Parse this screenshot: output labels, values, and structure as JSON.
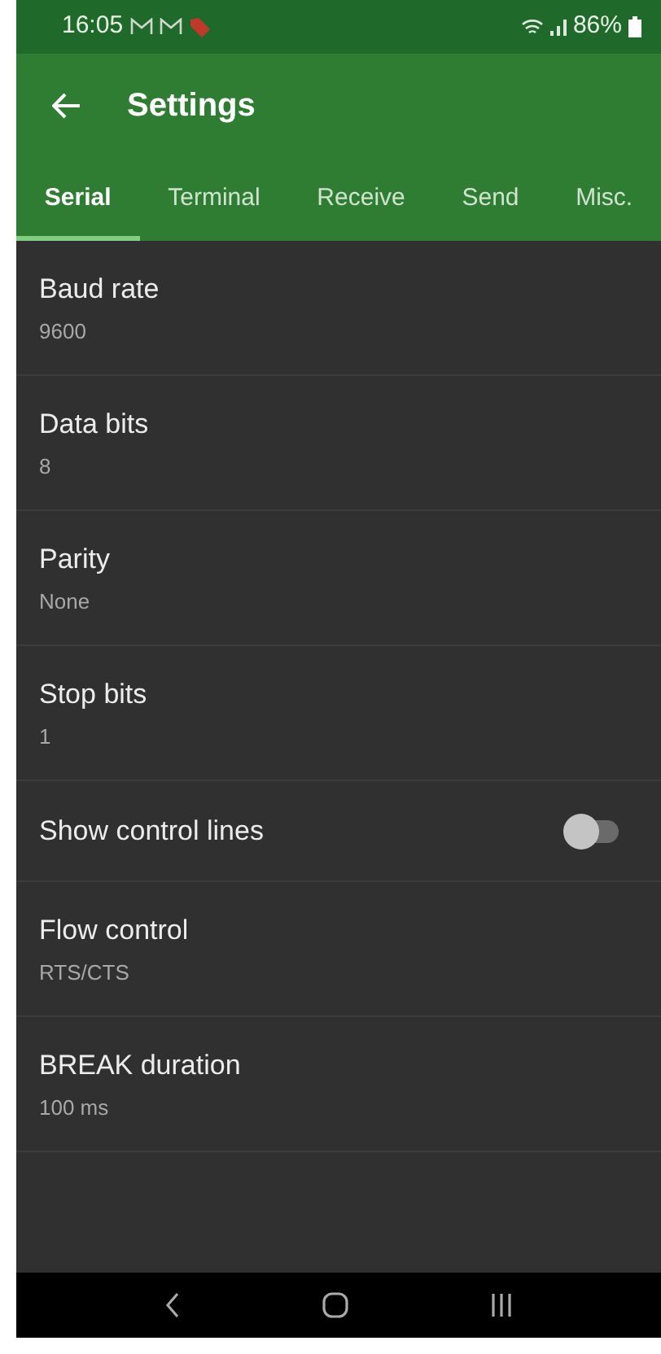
{
  "status_bar": {
    "time": "16:05",
    "battery": "86%"
  },
  "app_bar": {
    "title": "Settings"
  },
  "tabs": [
    {
      "label": "Serial",
      "selected": true
    },
    {
      "label": "Terminal",
      "selected": false
    },
    {
      "label": "Receive",
      "selected": false
    },
    {
      "label": "Send",
      "selected": false
    },
    {
      "label": "Misc.",
      "selected": false
    }
  ],
  "settings": [
    {
      "kind": "value",
      "title": "Baud rate",
      "value": "9600"
    },
    {
      "kind": "value",
      "title": "Data bits",
      "value": "8"
    },
    {
      "kind": "value",
      "title": "Parity",
      "value": "None"
    },
    {
      "kind": "value",
      "title": "Stop bits",
      "value": "1"
    },
    {
      "kind": "switch",
      "title": "Show control lines",
      "on": false
    },
    {
      "kind": "value",
      "title": "Flow control",
      "value": "RTS/CTS"
    },
    {
      "kind": "value",
      "title": "BREAK duration",
      "value": "100 ms"
    }
  ]
}
